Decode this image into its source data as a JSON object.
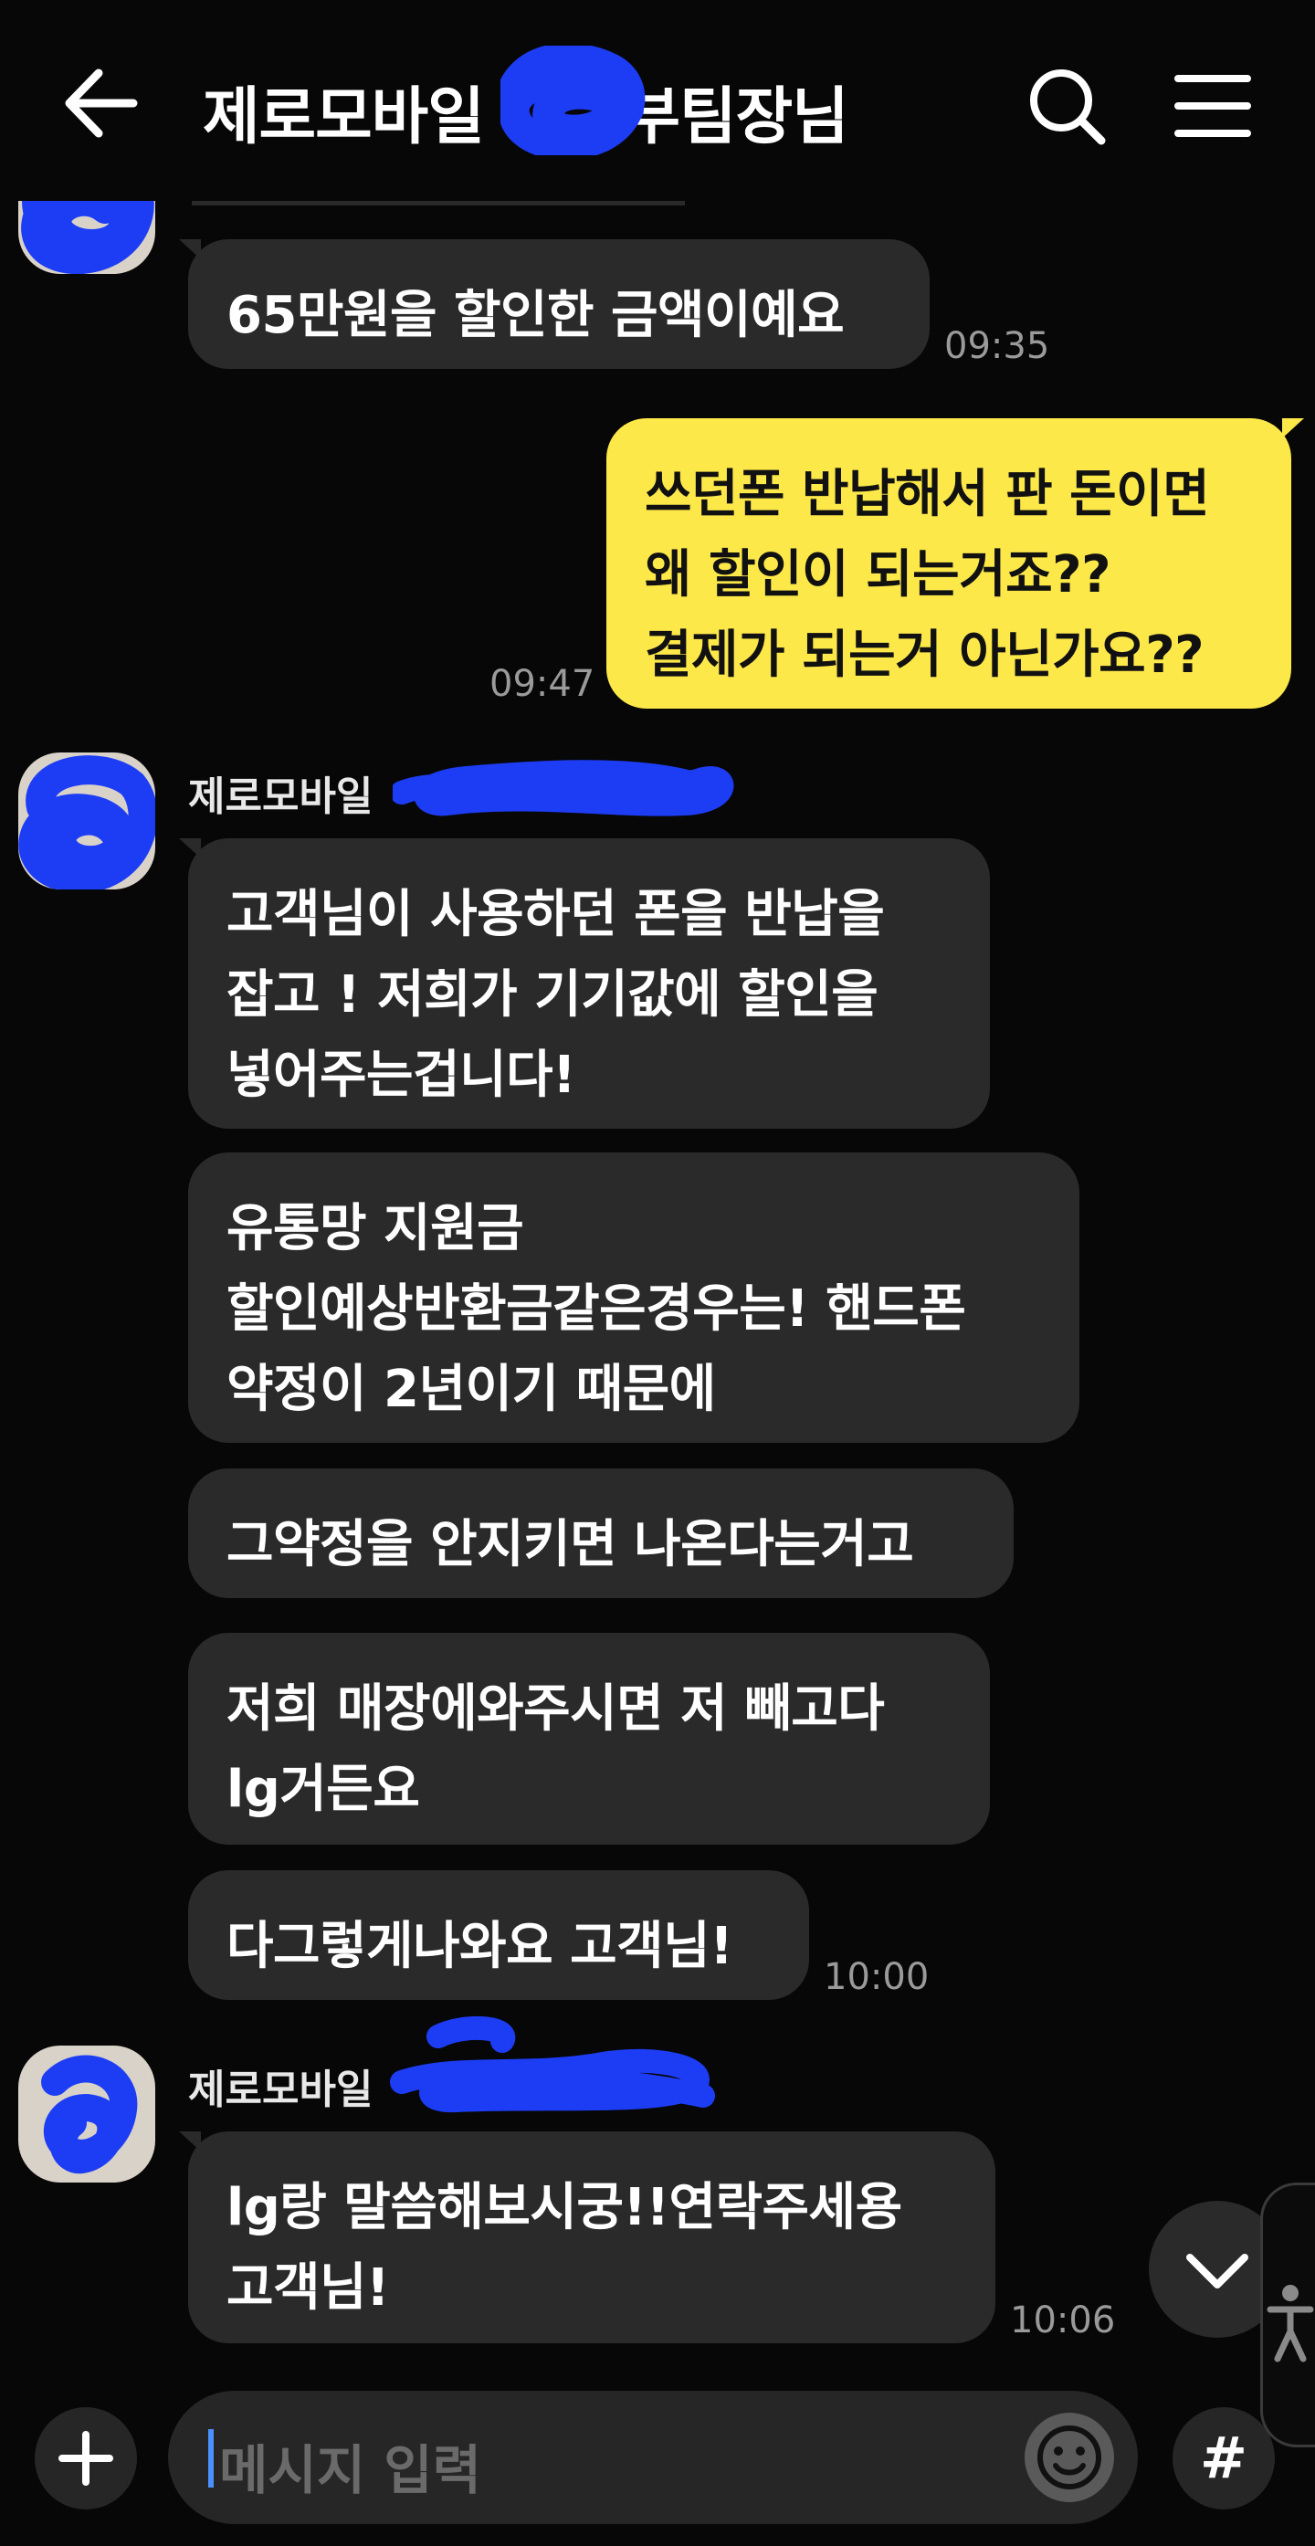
{
  "header": {
    "title": "제로모바일 ",
    "title_suffix": "부팀장님"
  },
  "messages": [
    {
      "text_lines": [
        "65만원을 할인한 금액이예요"
      ],
      "time": "09:35"
    },
    {
      "text_lines": [
        "쓰던폰 반납해서 판 돈이면",
        "왜 할인이 되는거죠??",
        "결제가 되는거 아닌가요??"
      ],
      "time": "09:47"
    },
    {
      "sender": "제로모바일"
    },
    {
      "text_lines": [
        "고객님이 사용하던 폰을 반납을",
        "잡고 ! 저희가 기기값에 할인을",
        "넣어주는겁니다!"
      ]
    },
    {
      "text_lines": [
        "유통망 지원금",
        "할인예상반환금같은경우는! 핸드폰",
        "약정이 2년이기 때문에"
      ]
    },
    {
      "text_lines": [
        "그약정을 안지키면 나온다는거고"
      ]
    },
    {
      "text_lines": [
        "저희 매장에와주시면 저 빼고다",
        "lg거든요"
      ]
    },
    {
      "text_lines": [
        "다그렇게나와요 고객님!"
      ],
      "time": "10:00"
    },
    {
      "sender": "제로모바일"
    },
    {
      "text_lines": [
        "lg랑 말씀해보시궁!!연락주세용",
        "고객님!"
      ],
      "time": "10:06"
    }
  ],
  "input": {
    "placeholder": "메시지 입력",
    "hash_label": "#"
  },
  "colors": {
    "background": "#070707",
    "my_bubble": "#fde84a",
    "their_bubble": "#2a2a2a",
    "redaction_scribble": "#1d3df5"
  },
  "icons": {
    "back": "arrow-left-icon",
    "search": "search-icon",
    "menu": "hamburger-menu-icon",
    "scroll": "chevron-down-icon",
    "accessibility": "accessibility-icon",
    "add": "plus-icon",
    "emoji": "emoji-icon"
  }
}
